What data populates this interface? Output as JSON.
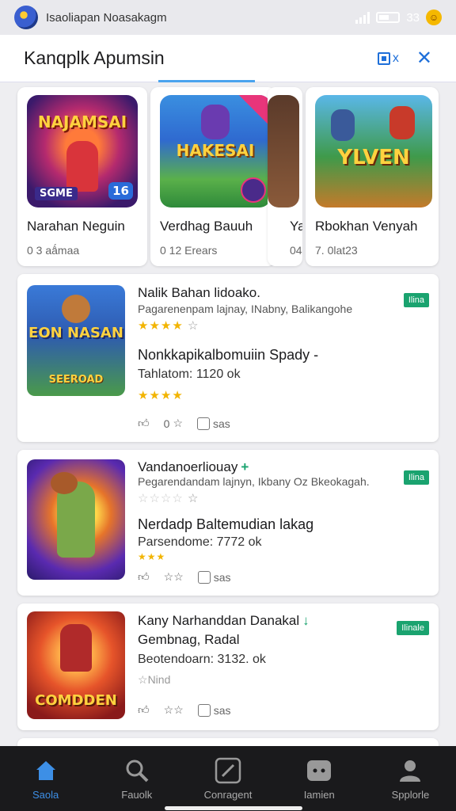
{
  "status_bar": {
    "title": "Isaoliapan Noasakagm",
    "battery_text": "33"
  },
  "header": {
    "title": "Kanqplk Apumsin",
    "action_label": "x"
  },
  "carousel": [
    {
      "name": "Narahan Neguin",
      "meta": "0 3 aǻmaa",
      "art_text": "NAJAMSAI",
      "art_sub": "SGME",
      "art_badge": "16"
    },
    {
      "name": "Verdhag Bauuh",
      "meta": "0 12 Erears",
      "art_text": "HAKESAI"
    },
    {
      "name": "Ya",
      "meta": "04"
    },
    {
      "name": "Rbokhan Venyah",
      "meta": "7. 0lat23",
      "art_text": "YLVEN"
    }
  ],
  "list": [
    {
      "title": "Nalik Bahan lidoako.",
      "subtitle": "Pagarenenpam lajnay, INabny, Balikangohe",
      "title2": "Nonkkapikalbomuiin Spady -",
      "meta": "Tahlatom: 1120  ok",
      "badge": "Ilina",
      "art_text": "EON NASAN",
      "art_sub": "SEEROAD",
      "act1": "0",
      "act2": "sas"
    },
    {
      "title": "Vandanoerliouay",
      "subtitle": "Pegarendandam lajnyn, Ikbany Oz Bkeokagah.",
      "title2": "Nerdadp Baltemudian lakag",
      "meta": "Parsendome: 7772  ok",
      "badge": "Ilina",
      "act2": "sas"
    },
    {
      "title": "Kany Narhanddan Danakal",
      "subtitle": "Gembnag, Radal",
      "meta": "Beotendoarn: 3132. ok",
      "extra": "Nind",
      "badge": "Ilinale",
      "art_text": "COMDDEN",
      "act2": "sas"
    }
  ],
  "bottom_nav": [
    {
      "label": "Saola",
      "icon": "home-icon",
      "active": true
    },
    {
      "label": "Fauolk",
      "icon": "search-icon"
    },
    {
      "label": "Conragent",
      "icon": "compass-icon"
    },
    {
      "label": "Iamien",
      "icon": "gamepad-icon"
    },
    {
      "label": "Spplorle",
      "icon": "profile-icon"
    }
  ],
  "colors": {
    "accent": "#1e6fd9",
    "badge": "#1aa36f",
    "star": "#f2b400",
    "nav_active": "#3d8fe6"
  }
}
